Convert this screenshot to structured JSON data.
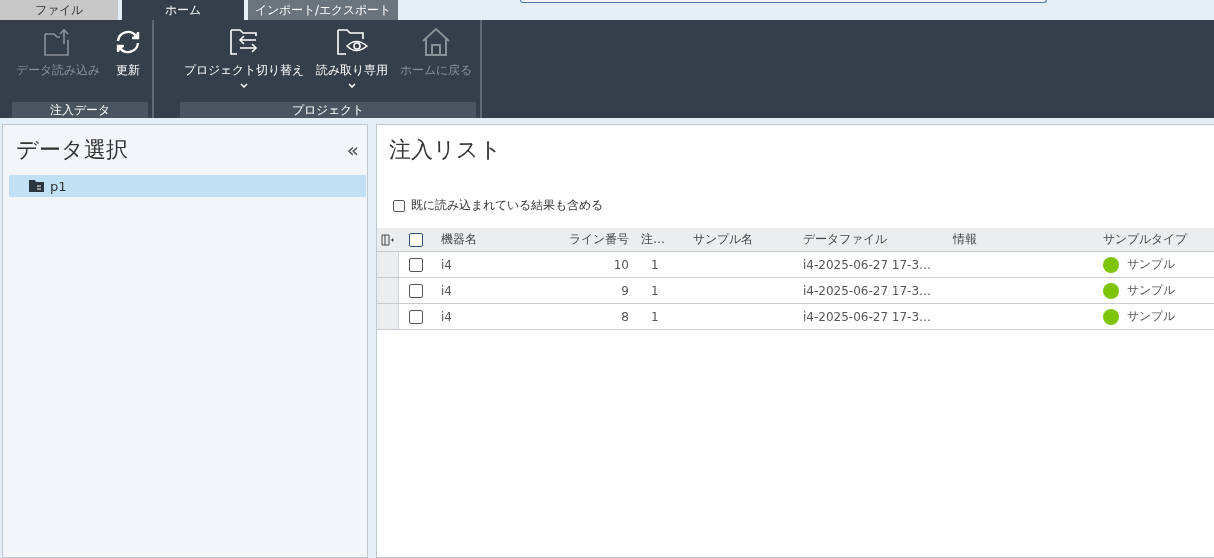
{
  "tabs": [
    {
      "label": "ファイル",
      "selected": false,
      "kind": "file"
    },
    {
      "label": "ホーム",
      "selected": true,
      "kind": "normal"
    },
    {
      "label": "インポート/エクスポート",
      "selected": false,
      "kind": "normal"
    }
  ],
  "ribbon": {
    "groups": [
      {
        "label": "注入データ",
        "buttons": [
          {
            "label": "データ読み込み",
            "disabled": true,
            "dropdown": false
          },
          {
            "label": "更新",
            "disabled": false,
            "dropdown": false
          }
        ]
      },
      {
        "label": "プロジェクト",
        "buttons": [
          {
            "label": "プロジェクト切り替え",
            "disabled": false,
            "dropdown": true
          },
          {
            "label": "読み取り専用",
            "disabled": false,
            "dropdown": true
          },
          {
            "label": "ホームに戻る",
            "disabled": true,
            "dropdown": false
          }
        ]
      }
    ]
  },
  "sidebar": {
    "title": "データ選択",
    "collapse": "«",
    "items": [
      {
        "label": "p1",
        "selected": true
      }
    ]
  },
  "main": {
    "title": "注入リスト",
    "option": {
      "label": "既に読み込まれている結果も含める",
      "checked": false
    },
    "table": {
      "all_checked": false,
      "columns": [
        "機器名",
        "ライン番号",
        "注…",
        "サンプル名",
        "データファイル",
        "情報",
        "サンプルタイプ"
      ],
      "rows": [
        {
          "cells": [
            "i4",
            "10",
            "1",
            "",
            "i4-2025-06-27 17-3…",
            "",
            "サンプル"
          ],
          "checked": false,
          "color": "#7dc40a"
        },
        {
          "cells": [
            "i4",
            "9",
            "1",
            "",
            "i4-2025-06-27 17-3…",
            "",
            "サンプル"
          ],
          "checked": false,
          "color": "#7dc40a"
        },
        {
          "cells": [
            "i4",
            "8",
            "1",
            "",
            "i4-2025-06-27 17-3…",
            "",
            "サンプル"
          ],
          "checked": false,
          "color": "#7dc40a"
        }
      ]
    }
  }
}
